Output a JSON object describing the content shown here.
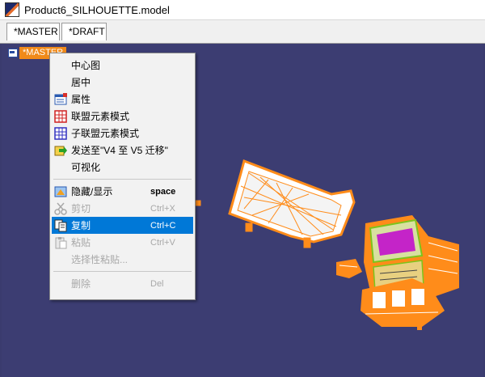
{
  "window": {
    "title": "Product6_SILHOUETTE.model"
  },
  "tabs": [
    {
      "label": "*MASTER"
    },
    {
      "label": "*DRAFT"
    }
  ],
  "tree": {
    "root_label": "*MASTER"
  },
  "context_menu": {
    "items": [
      {
        "label": "中心图",
        "shortcut": "",
        "icon": "",
        "enabled": true
      },
      {
        "label": "居中",
        "shortcut": "",
        "icon": "",
        "enabled": true
      },
      {
        "label": "属性",
        "shortcut": "",
        "icon": "properties-icon",
        "enabled": true
      },
      {
        "label": "联盟元素模式",
        "shortcut": "",
        "icon": "federation-grid-icon",
        "enabled": true
      },
      {
        "label": "子联盟元素模式",
        "shortcut": "",
        "icon": "sub-federation-grid-icon",
        "enabled": true
      },
      {
        "label": "发送至\"V4 至 V5 迁移\"",
        "shortcut": "",
        "icon": "send-to-icon",
        "enabled": true
      },
      {
        "label": "可视化",
        "shortcut": "",
        "icon": "",
        "enabled": true
      },
      {
        "label": "隐藏/显示",
        "shortcut": "space",
        "icon": "hide-show-icon",
        "enabled": true
      },
      {
        "label": "剪切",
        "shortcut": "Ctrl+X",
        "icon": "scissors-icon",
        "enabled": false
      },
      {
        "label": "复制",
        "shortcut": "Ctrl+C",
        "icon": "copy-icon",
        "enabled": true,
        "selected": true
      },
      {
        "label": "粘贴",
        "shortcut": "Ctrl+V",
        "icon": "paste-icon",
        "enabled": false
      },
      {
        "label": "选择性粘贴...",
        "shortcut": "",
        "icon": "",
        "enabled": false
      },
      {
        "label": "删除",
        "shortcut": "Del",
        "icon": "",
        "enabled": false
      }
    ]
  },
  "colors": {
    "viewport_bg": "#3c3d72",
    "model_wire": "#ff8c1a",
    "highlight": "#0078d7",
    "tree_label_bg": "#f08a1a"
  }
}
